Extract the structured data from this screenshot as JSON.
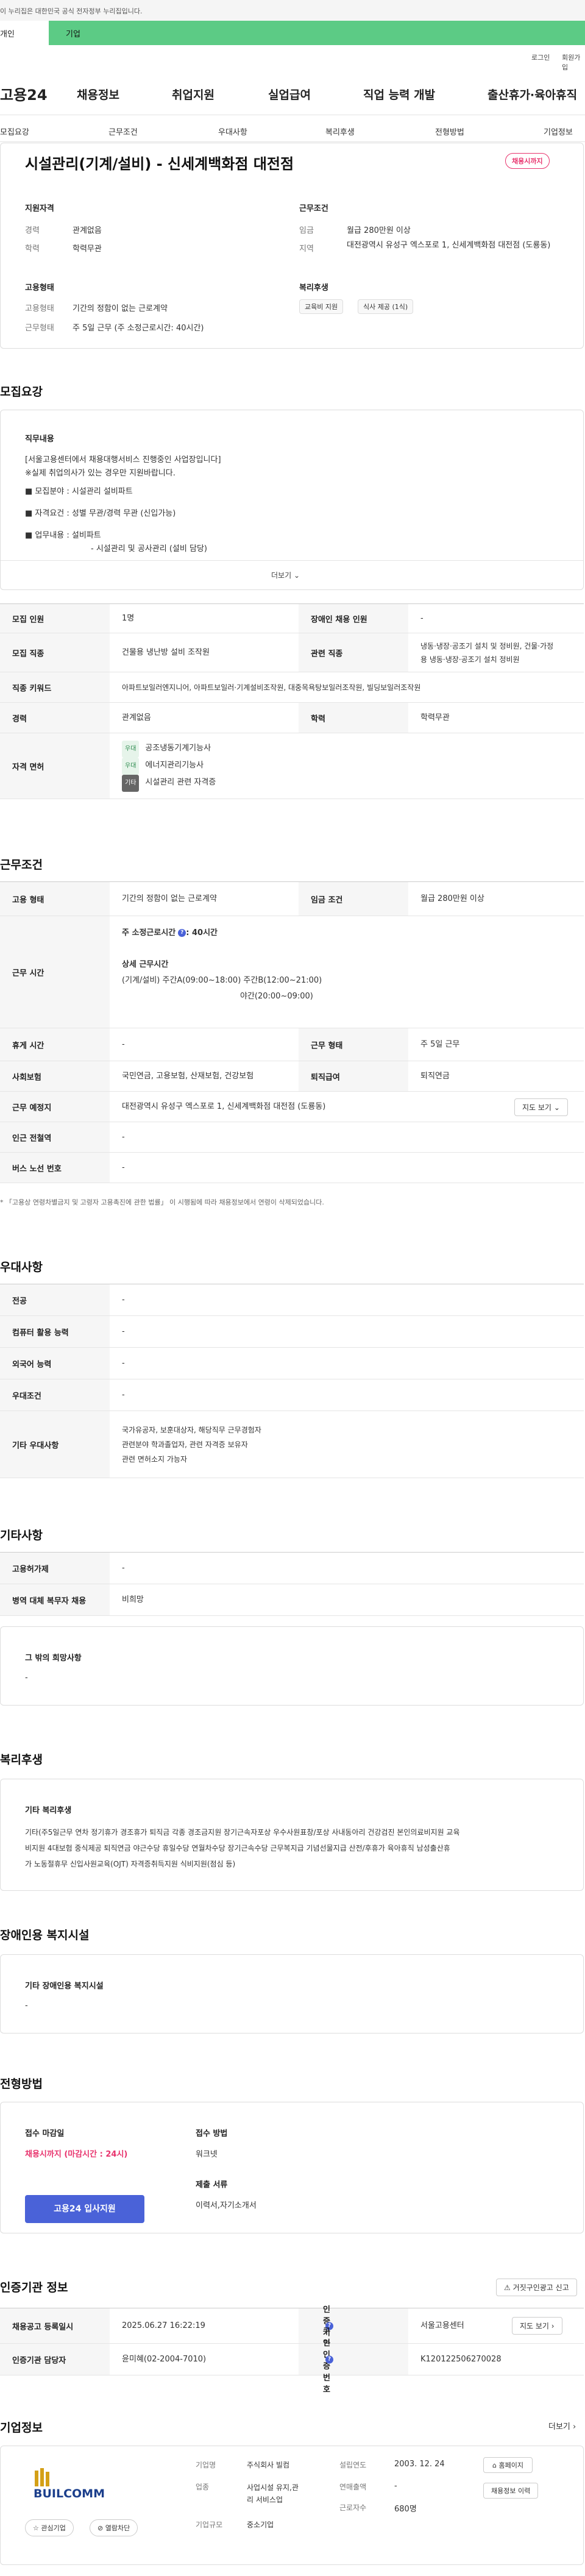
{
  "gov_notice": "이 누리집은 대한민국 공식 전자정부 누리집입니다.",
  "top_tabs": [
    "개인",
    "기업"
  ],
  "util_links": [
    "로그인",
    "회원가입"
  ],
  "logo": "고용24",
  "gnb": [
    "채용정보",
    "취업지원",
    "실업급여",
    "직업 능력 개발",
    "출산휴가·육아휴직"
  ],
  "sub_tabs": [
    "모집요강",
    "근무조건",
    "우대사항",
    "복리후생",
    "전형방법",
    "기업정보"
  ],
  "summary": {
    "title": "시설관리(기계/설비) - 신세계백화점 대전점",
    "badge": "채용시까지",
    "qual_title": "지원자격",
    "career_k": "경력",
    "career_v": "관계없음",
    "edu_k": "학력",
    "edu_v": "학력무관",
    "cond_title": "근무조건",
    "wage_k": "임금",
    "wage_v": "월급 280만원 이상",
    "area_k": "지역",
    "area_v": "대전광역시 유성구 엑스포로 1, 신세계백화점 대전점 (도룡동)",
    "type_title": "고용형태",
    "etype_k": "고용형태",
    "etype_v": "기간의 정함이 없는 근로계약",
    "wtype_k": "근무형태",
    "wtype_v": "주 5일 근무 (주 소정근로시간: 40시간)",
    "welfare_title": "복리후생",
    "welfare_chips": [
      "교육비 지원",
      "식사 제공 (1식)"
    ]
  },
  "recruit": {
    "section": "모집요강",
    "duty_title": "직무내용",
    "lines": [
      "[서울고용센터에서 채용대행서비스 진행중인 사업장입니다]",
      "※실제 취업의사가 있는 경우만 지원바랍니다.",
      "■ 모집분야 : 시설관리 설비파트",
      "■ 자격요건 : 성별 무관/경력 무관 (신입가능)",
      "■ 업무내용 :  설비파트",
      "- 시설관리 및 공사관리 (설비 담당)"
    ],
    "more": "더보기",
    "rows": {
      "count_k": "모집 인원",
      "count_v": "1명",
      "disabled_k": "장애인 채용 인원",
      "disabled_v": "-",
      "job_k": "모집 직종",
      "job_v": "건물용 냉난방 설비 조작원",
      "related_k": "관련 직종",
      "related_v1": "냉동·냉장·공조기 설치 및 정비원, 건물·가정",
      "related_v2": "용 냉동·냉장·공조기 설치 정비원",
      "kw_k": "직종 키워드",
      "kw_v": "아파트보일러엔지니어, 아파트보일러·기계설비조작원, 대중목욕탕보일러조작원, 빌딩보일러조작원",
      "career_k": "경력",
      "career_v": "관계없음",
      "edu_k": "학력",
      "edu_v": "학력무관",
      "license_k": "자격 면허",
      "licenses": [
        {
          "tag": "우대",
          "name": "공조냉동기계기능사"
        },
        {
          "tag": "우대",
          "name": "에너지관리기능사"
        },
        {
          "tag": "기타",
          "name": "시설관리 관련 자격증"
        }
      ]
    }
  },
  "work": {
    "section": "근무조건",
    "etype_k": "고용 형태",
    "etype_v": "기간의 정함이 없는 근로계약",
    "wage_k": "임금 조건",
    "wage_v": "월급 280만원 이상",
    "hours_k": "근무 시간",
    "weekly": "주 소정근로시간",
    "weekly_v": ": 40시간",
    "detail_title": "상세 근무시간",
    "detail1": "(기계/설비) 주간A(09:00~18:00) 주간B(12:00~21:00)",
    "detail2": "야간(20:00~09:00)",
    "rest_k": "휴게 시간",
    "rest_v": "-",
    "wform_k": "근무 형태",
    "wform_v": "주 5일 근무",
    "ins_k": "사회보험",
    "ins_v": "국민연금, 고용보험, 산재보험, 건강보험",
    "sev_k": "퇴직급여",
    "sev_v": "퇴직연금",
    "place_k": "근무 예정지",
    "place_v": "대전광역시 유성구 엑스포로 1, 신세계백화점 대전점 (도룡동)",
    "map_btn": "지도 보기",
    "subway_k": "인근 전철역",
    "subway_v": "-",
    "bus_k": "버스 노선 번호",
    "bus_v": "-",
    "note": "* 「고용상 연령차별금지 및 고령자 고용촉진에 관한 법률」 이 시행됨에 따라 채용정보에서 연령이 삭제되었습니다."
  },
  "pref": {
    "section": "우대사항",
    "lang_k": "전공",
    "lang_v": "-",
    "pc_k": "컴퓨터 활용 능력",
    "pc_v": "-",
    "foreign_k": "외국어 능력",
    "foreign_v": "-",
    "cond_k": "우대조건",
    "cond_v": "-",
    "etc_k": "기타 우대사항",
    "etc_lines": [
      "국가유공자, 보훈대상자, 해당직무 근무경험자",
      "관련분야 학과졸업자, 관련 자격증 보유자",
      "관련 면허소지 가능자"
    ]
  },
  "other": {
    "section": "기타사항",
    "emp_k": "고용허가제",
    "emp_v": "-",
    "mil_k": "병역 대체 복무자 채용",
    "mil_v": "비희망",
    "wish_title": "그 밖의 희망사항",
    "wish_v": "-"
  },
  "welfare": {
    "section": "복리후생",
    "title": "기타 복리후생",
    "line1": "기타(주5일근무 연차 정기휴가 경조휴가 퇴직금 각종 경조금지원 장기근속자포상 우수사원표창/포상 사내동아리 건강검진 본인의료비지원 교육",
    "line2": "비지원 4대보험 중식제공 퇴직연금 야근수당 휴일수당 연월차수당 장기근속수당 근무복지급 기념선물지급 산전/후휴가 육아휴직 남성출산휴",
    "line3": "가 노동절휴무 신입사원교육(OJT) 자격증취득지원 식비지원(점심 등)"
  },
  "disability": {
    "section": "장애인용 복지시설",
    "title": "기타 장애인용 복지시설",
    "v": "-"
  },
  "method": {
    "section": "전형방법",
    "deadline_k": "접수 마감일",
    "deadline_v": "채용시까지 (마감시간 : 24시)",
    "apply_btn": "고용24 입사지원",
    "way_k": "접수 방법",
    "way_v": "워크넷",
    "docs_k": "제출 서류",
    "docs_v": "이력서,자기소개서"
  },
  "auth": {
    "section": "인증기관 정보",
    "report_btn": "거짓구인광고 신고",
    "reg_k": "채용공고 등록일시",
    "reg_v": "2025.06.27 16:22:19",
    "org_k": "인증기관",
    "org_v": "서울고용센터",
    "map_btn": "지도 보기",
    "mgr_k": "인증기관 담당자",
    "mgr_v": "윤미혜(02-2004-7010)",
    "num_k": "구인인증번호",
    "num_v": "K120122506270028"
  },
  "company": {
    "section": "기업정보",
    "more": "더보기",
    "logo_text": "BUILCOMM",
    "fav_btn": "관심기업",
    "block_btn": "열람차단",
    "name_k": "기업명",
    "name_v": "주식회사 빌컴",
    "est_k": "설립연도",
    "est_v": "2003. 12. 24",
    "home_btn": "홈페이지",
    "ind_k": "업종",
    "ind_v1": "사업시설 유지,관",
    "ind_v2": "리 서비스업",
    "rev_k": "연매출액",
    "rev_v": "-",
    "emp_k": "근로자수",
    "emp_v": "680명",
    "list_btn": "채용정보 이력",
    "size_k": "기업규모",
    "size_v": "중소기업"
  },
  "colors": {
    "accent": "#4a62d8",
    "badge": "#e8336d",
    "green": "#5ccb85"
  }
}
